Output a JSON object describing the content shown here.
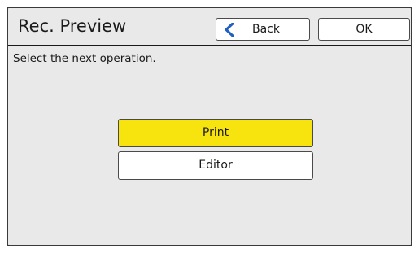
{
  "header": {
    "title": "Rec. Preview",
    "back_label": "Back",
    "back_icon": "chevron-left-icon",
    "ok_label": "OK"
  },
  "body": {
    "instruction": "Select the next operation.",
    "options": [
      {
        "label": "Print",
        "selected": true
      },
      {
        "label": "Editor",
        "selected": false
      }
    ]
  },
  "colors": {
    "accent_selected": "#f7e40f",
    "back_icon": "#1f5fbf",
    "background": "#e9e9e9"
  }
}
